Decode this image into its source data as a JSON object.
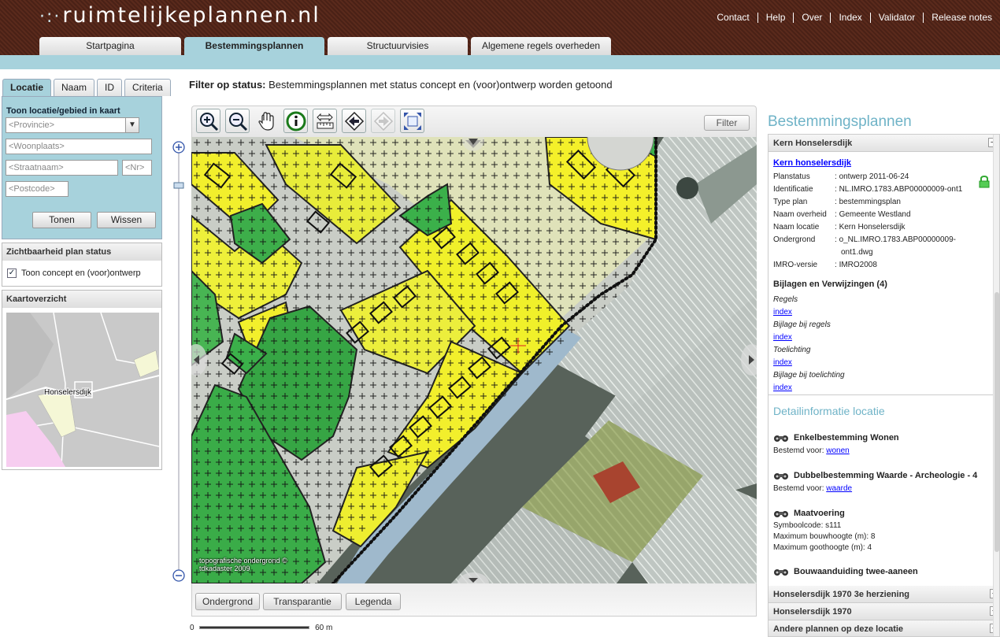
{
  "header": {
    "logo_prefix": "·:·",
    "logo_text": "ruimtelijkeplannen.nl",
    "top_links": [
      "Contact",
      "Help",
      "Over",
      "Index",
      "Validator",
      "Release notes"
    ],
    "tabs": [
      {
        "label": "Startpagina",
        "active": false
      },
      {
        "label": "Bestemmingsplannen",
        "active": true
      },
      {
        "label": "Structuurvisies",
        "active": false
      },
      {
        "label": "Algemene regels overheden",
        "active": false
      }
    ]
  },
  "left": {
    "tabs": [
      "Locatie",
      "Naam",
      "ID",
      "Criteria"
    ],
    "location_title": "Toon locatie/gebied in kaart",
    "province_placeholder": "<Provincie>",
    "woonplaats_placeholder": "<Woonplaats>",
    "straatnaam_placeholder": "<Straatnaam>",
    "nr_placeholder": "<Nr>",
    "postcode_placeholder": "<Postcode>",
    "show_button": "Tonen",
    "clear_button": "Wissen",
    "visibility_title": "Zichtbaarheid plan status",
    "visibility_checkbox": "Toon concept en (voor)ontwerp",
    "overview_title": "Kaartoverzicht",
    "overview_label": "Honselersdijk"
  },
  "filter": {
    "label": "Filter op status:",
    "text": "Bestemmingsplannen met status concept en (voor)ontwerp worden getoond"
  },
  "map": {
    "filter_button": "Filter",
    "copyright_line1": "topografische ondergrond ©",
    "copyright_line2": "tdkadaster 2009",
    "bottom_buttons": [
      "Ondergrond",
      "Transparantie",
      "Legenda"
    ],
    "scale_start": "0",
    "scale_end": "60 m"
  },
  "right": {
    "title": "Bestemmingsplannen",
    "open_plan_header": "Kern Honselersdijk",
    "plan_link": "Kern honselersdijk",
    "details": [
      {
        "k": "Planstatus",
        "v": "ontwerp 2011-06-24"
      },
      {
        "k": "Identificatie",
        "v": "NL.IMRO.1783.ABP00000009-ont1"
      },
      {
        "k": "Type plan",
        "v": "bestemmingsplan"
      },
      {
        "k": "Naam overheid",
        "v": "Gemeente Westland"
      },
      {
        "k": "Naam locatie",
        "v": "Kern Honselersdijk"
      },
      {
        "k": "Ondergrond",
        "v": "o_NL.IMRO.1783.ABP00000009-ont1.dwg"
      },
      {
        "k": "IMRO-versie",
        "v": "IMRO2008"
      }
    ],
    "attachments_title": "Bijlagen en Verwijzingen (4)",
    "attachments": [
      {
        "name": "Regels",
        "link": "index"
      },
      {
        "name": "Bijlage bij regels",
        "link": "index"
      },
      {
        "name": "Toelichting",
        "link": "index"
      },
      {
        "name": "Bijlage bij toelichting",
        "link": "index"
      }
    ],
    "detail_title": "Detailinformatie locatie",
    "detail_blocks": [
      {
        "title": "Enkelbestemming Wonen",
        "lines": [
          {
            "prefix": "Bestemd voor: ",
            "link": "wonen"
          }
        ]
      },
      {
        "title": "Dubbelbestemming Waarde - Archeologie - 4",
        "lines": [
          {
            "prefix": "Bestemd voor: ",
            "link": "waarde"
          }
        ]
      },
      {
        "title": "Maatvoering",
        "lines": [
          {
            "prefix": "Symboolcode: s111"
          },
          {
            "prefix": "Maximum bouwhoogte (m): 8"
          },
          {
            "prefix": "Maximum goothoogte (m): 4"
          }
        ]
      },
      {
        "title": "Bouwaanduiding twee-aaneen",
        "lines": []
      }
    ],
    "other_plans": [
      "Honselersdijk 1970 3e herziening",
      "Honselersdijk 1970",
      "Andere plannen op deze locatie"
    ]
  },
  "colors": {
    "brand_blue": "#a7d2dc",
    "header_brown": "#4a2116",
    "heading_blue": "#6fb3c7",
    "residential_yellow": "#f2ef2c",
    "green_zone": "#3bb04a"
  }
}
